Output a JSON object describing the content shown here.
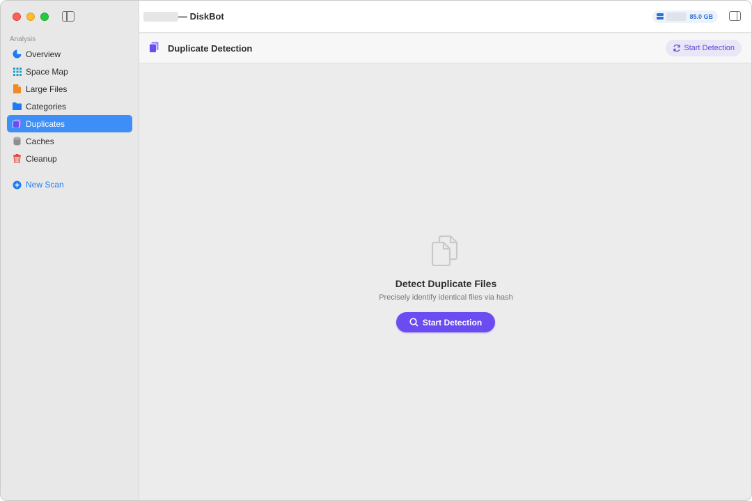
{
  "window": {
    "title": "— DiskBot"
  },
  "sidebar": {
    "section_label": "Analysis",
    "items": [
      {
        "label": "Overview",
        "icon": "pie-chart-icon",
        "color": "#1f7bf2"
      },
      {
        "label": "Space Map",
        "icon": "grid-icon",
        "color": "#18a0c9"
      },
      {
        "label": "Large Files",
        "icon": "document-icon",
        "color": "#f08a24"
      },
      {
        "label": "Categories",
        "icon": "folder-icon",
        "color": "#1f7bf2"
      },
      {
        "label": "Duplicates",
        "icon": "duplicate-docs-icon",
        "color": "#6a4cf0",
        "active": true
      },
      {
        "label": "Caches",
        "icon": "cylinder-icon",
        "color": "#8e8e8e"
      },
      {
        "label": "Cleanup",
        "icon": "trash-icon",
        "color": "#e5463c"
      }
    ],
    "new_scan_label": "New Scan"
  },
  "titlebar": {
    "disk_size": "85.0 GB"
  },
  "toolbar": {
    "title": "Duplicate Detection",
    "action_label": "Start Detection"
  },
  "empty_state": {
    "title": "Detect Duplicate Files",
    "subtitle": "Precisely identify identical files via hash",
    "button_label": "Start Detection"
  },
  "colors": {
    "accent": "#6a4cf0",
    "selection": "#3e8ef7",
    "link": "#1f7bf2"
  }
}
